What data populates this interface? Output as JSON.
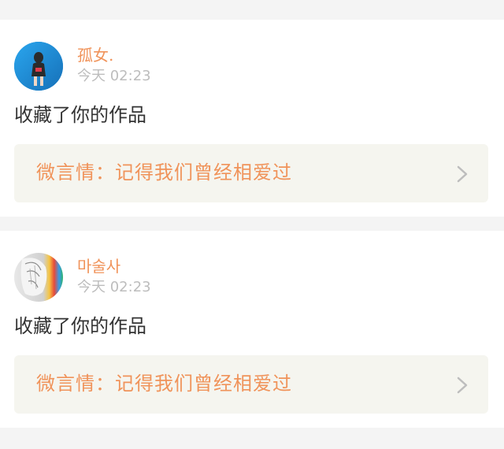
{
  "notifications": [
    {
      "username": "孤女.",
      "time": "今天 02:23",
      "action": "收藏了你的作品",
      "work_title": "微言情：记得我们曾经相爱过",
      "avatar_icon": "user-avatar-photo-icon"
    },
    {
      "username": "마술사",
      "time": "今天 02:23",
      "action": "收藏了你的作品",
      "work_title": "微言情：记得我们曾经相爱过",
      "avatar_icon": "user-avatar-illustration-icon"
    }
  ],
  "colors": {
    "accent": "#f0935a",
    "muted": "#bdbdbd",
    "text": "#333333",
    "link_bg": "#f5f5ef",
    "page_bg": "#f4f4f4"
  }
}
